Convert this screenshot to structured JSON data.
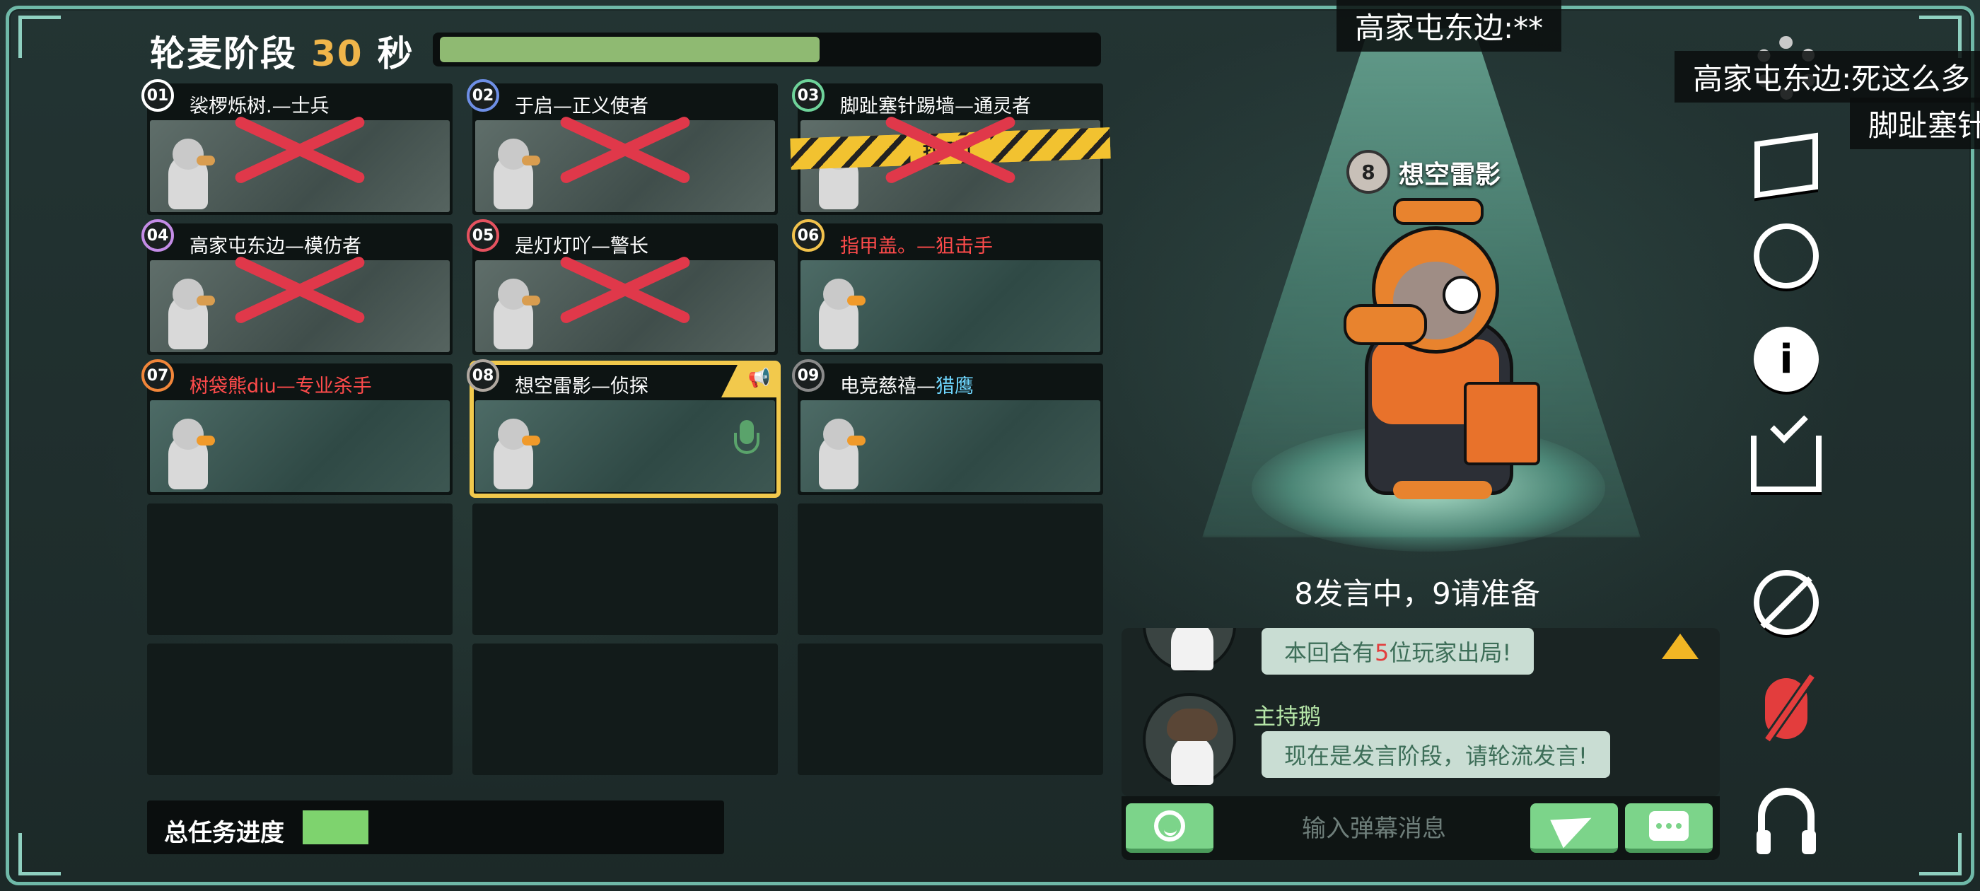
{
  "header": {
    "phase_label": "轮麦阶段",
    "seconds": "30",
    "seconds_unit": "秒",
    "timer_progress": 0.58
  },
  "players": [
    {
      "num": "01",
      "name": "裟椤烁树.",
      "role": "士兵",
      "role_color": "white",
      "badge_color": "#ffffff",
      "status": "dead"
    },
    {
      "num": "02",
      "name": "于启",
      "role": "正义使者",
      "role_color": "white",
      "badge_color": "#6e8fe6",
      "status": "dead"
    },
    {
      "num": "03",
      "name": "脚趾塞针踢墙",
      "role": "通灵者",
      "role_color": "white",
      "badge_color": "#6ed39a",
      "status": "dead",
      "tape": "找到了"
    },
    {
      "num": "04",
      "name": "高家屯东边",
      "role": "模仿者",
      "role_color": "white",
      "badge_color": "#c48ce6",
      "status": "dead"
    },
    {
      "num": "05",
      "name": "是灯灯吖",
      "role": "警长",
      "role_color": "white",
      "badge_color": "#e6525f",
      "status": "dead"
    },
    {
      "num": "06",
      "name": "指甲盖。",
      "role": "狙击手",
      "role_color": "red",
      "badge_color": "#f2c24c",
      "status": "alive"
    },
    {
      "num": "07",
      "name": "树袋熊diu",
      "role": "专业杀手",
      "role_color": "red",
      "badge_color": "#f2863a",
      "status": "alive"
    },
    {
      "num": "08",
      "name": "想空雷影",
      "role": "侦探",
      "role_color": "white",
      "badge_color": "#b0a8a0",
      "status": "self"
    },
    {
      "num": "09",
      "name": "电竞慈禧",
      "role": "猎鹰",
      "role_color": "blue",
      "badge_color": "#8a8a8a",
      "status": "alive"
    }
  ],
  "task": {
    "label": "总任务进度",
    "progress": 0.16
  },
  "spotlight": {
    "num": "8",
    "name": "想空雷影",
    "status_text": "8发言中，9请准备"
  },
  "chat": {
    "msg1_prefix": "本回合有",
    "msg1_highlight": "5",
    "msg1_suffix": "位玩家出局!",
    "host_name": "主持鹅",
    "msg2": "现在是发言阶段，请轮流发言!",
    "input_placeholder": "输入弹幕消息"
  },
  "barrage": [
    "高家屯东边:**",
    "高家屯东边:死这么多",
    "脚趾塞针"
  ],
  "colors": {
    "accent_frame": "#6fb9a8",
    "timer_fill": "#8fba72",
    "task_fill": "#7ed36e",
    "self_outline": "#f2c94c",
    "button_green": "#7cd48a"
  },
  "icons": [
    "gear-icon",
    "map-icon",
    "target-icon",
    "info-icon",
    "task-checkin-icon",
    "no-vote-icon",
    "mic-muted-icon",
    "headset-icon"
  ]
}
